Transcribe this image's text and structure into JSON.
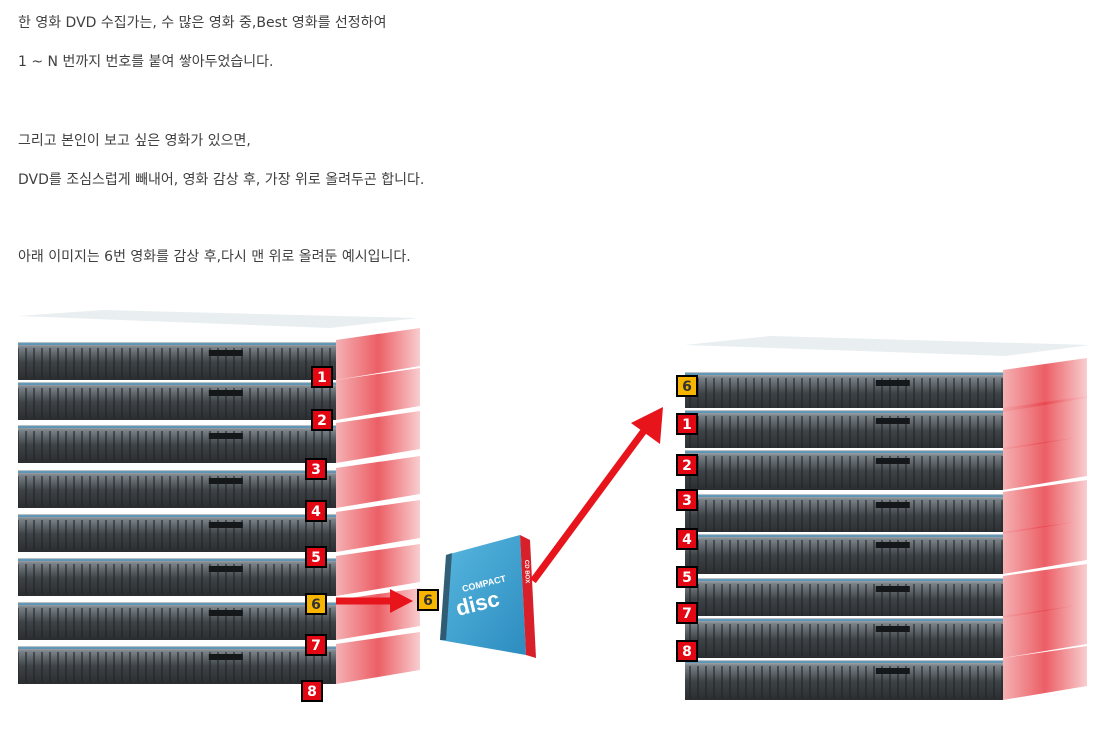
{
  "text": {
    "line1": "한 영화 DVD 수집가는, 수 많은 영화 중,Best 영화를 선정하여",
    "line2": "1 ~ N 번까지 번호를 붙여 쌓아두었습니다.",
    "line3": "그리고 본인이 보고 싶은 영화가 있으면,",
    "line4": "DVD를 조심스럽게 빼내어, 영화 감상 후, 가장 위로 올려두곤 합니다.",
    "line5": "아래 이미지는 6번 영화를 감상 후,다시 맨 위로 올려둔 예시입니다."
  },
  "illustration": {
    "left_stack_labels": [
      "1",
      "2",
      "3",
      "4",
      "5",
      "6",
      "7",
      "8"
    ],
    "right_stack_labels": [
      "6",
      "1",
      "2",
      "3",
      "4",
      "5",
      "7",
      "8"
    ],
    "removed_label": "6",
    "case_text_top": "COMPACT",
    "case_text_main": "disc",
    "case_text_side": "CD BOX",
    "colors": {
      "label_red": "#e30613",
      "label_yellow": "#f7b500",
      "arrow_red": "#e8141b",
      "case_blue": "#3aa0d0",
      "case_red": "#d8202a"
    }
  }
}
